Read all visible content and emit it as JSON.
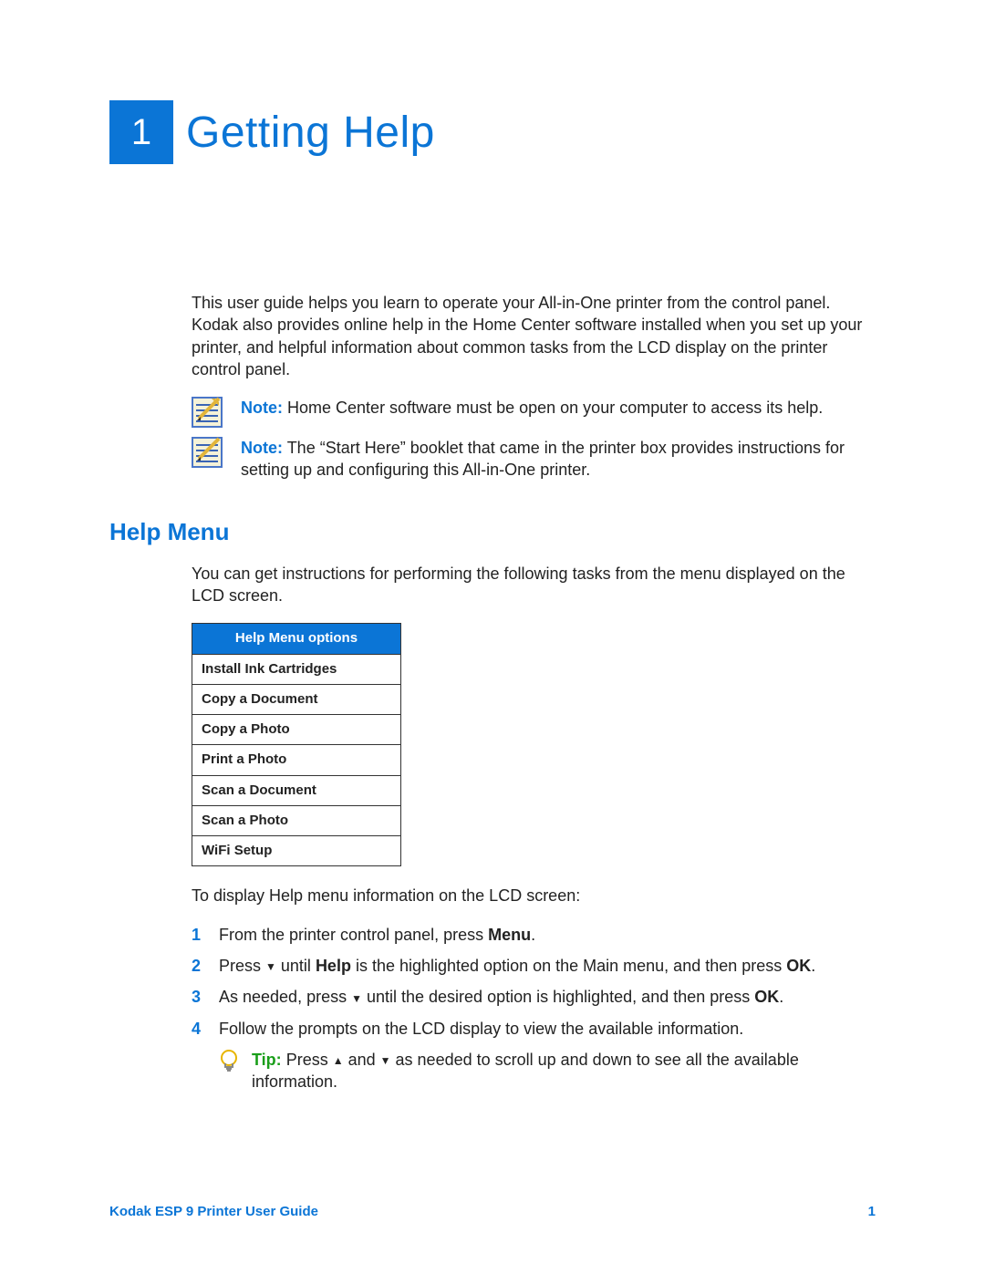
{
  "chapter": {
    "number": "1",
    "title": "Getting Help"
  },
  "intro": "This user guide helps you learn to operate your All-in-One printer from the control panel. Kodak also provides online help in the Home Center software installed when you set up your printer, and helpful information about common tasks from the LCD display on the printer control panel.",
  "notes": [
    {
      "label": "Note:",
      "text": "Home Center software must be open on your computer to access its help."
    },
    {
      "label": "Note:",
      "text": "The “Start Here” booklet that came in the printer box provides instructions for setting up and configuring this All-in-One printer."
    }
  ],
  "section": {
    "title": "Help Menu",
    "intro": "You can get instructions for performing the following tasks from the menu displayed on the LCD screen.",
    "table_header": "Help Menu options",
    "table_rows": [
      "Install Ink Cartridges",
      "Copy a Document",
      "Copy a Photo",
      "Print a Photo",
      "Scan a Document",
      "Scan a Photo",
      "WiFi Setup"
    ],
    "display_intro": "To display Help menu information on the LCD screen:",
    "steps": [
      {
        "n": "1",
        "pre": "From the printer control panel, press ",
        "b1": "Menu",
        "post": "."
      },
      {
        "n": "2",
        "pre": "Press ",
        "arrow1": "▼",
        "mid1": " until ",
        "b1": "Help",
        "mid2": " is the highlighted option on the Main menu, and then press ",
        "b2": "OK",
        "post": "."
      },
      {
        "n": "3",
        "pre": "As needed, press ",
        "arrow1": "▼",
        "mid1": " until the desired option is highlighted, and then press ",
        "b1": "OK",
        "post": "."
      },
      {
        "n": "4",
        "pre": "Follow the prompts on the LCD display to view the available information."
      }
    ],
    "tip": {
      "label": "Tip:",
      "pre": "Press ",
      "arrow_up": "▲",
      "mid": " and ",
      "arrow_down": "▼",
      "post": " as needed to scroll up and down to see all the available information."
    }
  },
  "footer": {
    "left": "Kodak ESP 9 Printer User Guide",
    "right": "1"
  }
}
